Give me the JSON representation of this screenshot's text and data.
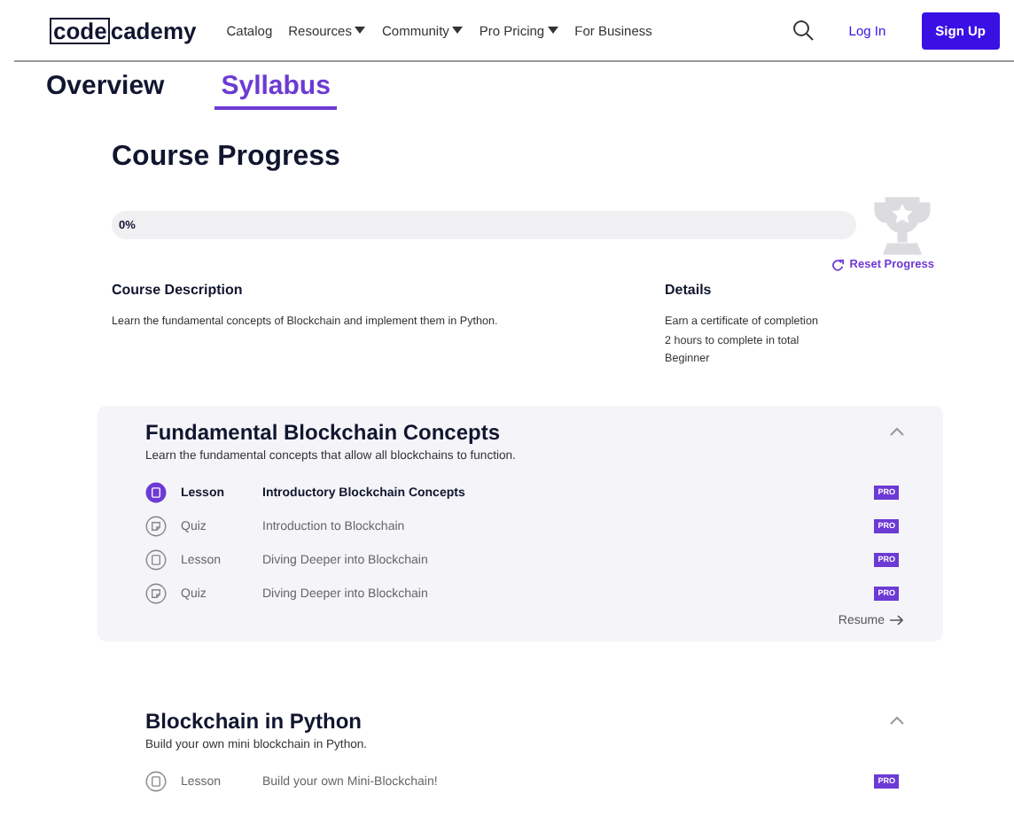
{
  "header": {
    "logo": {
      "boxed": "code",
      "rest": "cademy"
    },
    "nav": [
      {
        "label": "Catalog",
        "dropdown": false
      },
      {
        "label": "Resources",
        "dropdown": true
      },
      {
        "label": "Community",
        "dropdown": true
      },
      {
        "label": "Pro Pricing",
        "dropdown": true
      },
      {
        "label": "For Business",
        "dropdown": false
      }
    ],
    "login": "Log In",
    "signup": "Sign Up"
  },
  "tabs": [
    {
      "label": "Overview",
      "selected": false
    },
    {
      "label": "Syllabus",
      "selected": true
    }
  ],
  "progress": {
    "title": "Course Progress",
    "reading": "0%",
    "level": 0,
    "reset": "Reset Progress"
  },
  "description": {
    "heading": "Course Description",
    "text": "Learn the fundamental concepts of Blockchain and implement them in Python."
  },
  "details": {
    "heading": "Details",
    "lines": [
      "Earn a certificate of completion",
      "2 hours to complete in total",
      "Beginner"
    ]
  },
  "modules": [
    {
      "title": "Fundamental Blockchain Concepts",
      "subtitle": "Learn the fundamental concepts that allow all blockchains to function.",
      "expanded": true,
      "resume": "Resume",
      "items": [
        {
          "kind": "lesson",
          "type": "Lesson",
          "name": "Introductory Blockchain Concepts",
          "current": true,
          "badge": "PRO"
        },
        {
          "kind": "quiz",
          "type": "Quiz",
          "name": "Introduction to Blockchain",
          "current": false,
          "badge": "PRO"
        },
        {
          "kind": "lesson",
          "type": "Lesson",
          "name": "Diving Deeper into Blockchain",
          "current": false,
          "badge": "PRO"
        },
        {
          "kind": "quiz",
          "type": "Quiz",
          "name": "Diving Deeper into Blockchain",
          "current": false,
          "badge": "PRO"
        }
      ]
    },
    {
      "title": "Blockchain in Python",
      "subtitle": "Build your own mini blockchain in Python.",
      "expanded": true,
      "items": [
        {
          "kind": "lesson",
          "type": "Lesson",
          "name": "Build your own Mini-Blockchain!",
          "current": false,
          "badge": "PRO"
        }
      ]
    }
  ]
}
